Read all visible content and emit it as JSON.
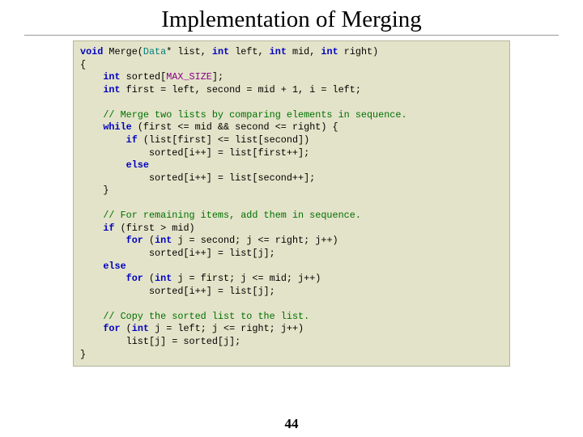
{
  "title": "Implementation of Merging",
  "pageNumber": "44",
  "code": {
    "l01a": "void",
    "l01b": " Merge(",
    "l01c": "Data",
    "l01d": "* list, ",
    "l01e": "int",
    "l01f": " left, ",
    "l01g": "int",
    "l01h": " mid, ",
    "l01i": "int",
    "l01j": " right)",
    "l02": "{",
    "l03a": "    ",
    "l03b": "int",
    "l03c": " sorted[",
    "l03d": "MAX_SIZE",
    "l03e": "];",
    "l04a": "    ",
    "l04b": "int",
    "l04c": " first = left, second = mid + 1, i = left;",
    "l06a": "    ",
    "l06b": "// Merge two lists by comparing elements in sequence.",
    "l07a": "    ",
    "l07b": "while",
    "l07c": " (first <= mid && second <= right) {",
    "l08a": "        ",
    "l08b": "if",
    "l08c": " (list[first] <= list[second])",
    "l09": "            sorted[i++] = list[first++];",
    "l10a": "        ",
    "l10b": "else",
    "l11": "            sorted[i++] = list[second++];",
    "l12": "    }",
    "l14a": "    ",
    "l14b": "// For remaining items, add them in sequence.",
    "l15a": "    ",
    "l15b": "if",
    "l15c": " (first > mid)",
    "l16a": "        ",
    "l16b": "for",
    "l16c": " (",
    "l16d": "int",
    "l16e": " j = second; j <= right; j++)",
    "l17": "            sorted[i++] = list[j];",
    "l18a": "    ",
    "l18b": "else",
    "l19a": "        ",
    "l19b": "for",
    "l19c": " (",
    "l19d": "int",
    "l19e": " j = first; j <= mid; j++)",
    "l20": "            sorted[i++] = list[j];",
    "l22a": "    ",
    "l22b": "// Copy the sorted list to the list.",
    "l23a": "    ",
    "l23b": "for",
    "l23c": " (",
    "l23d": "int",
    "l23e": " j = left; j <= right; j++)",
    "l24": "        list[j] = sorted[j];",
    "l25": "}"
  }
}
